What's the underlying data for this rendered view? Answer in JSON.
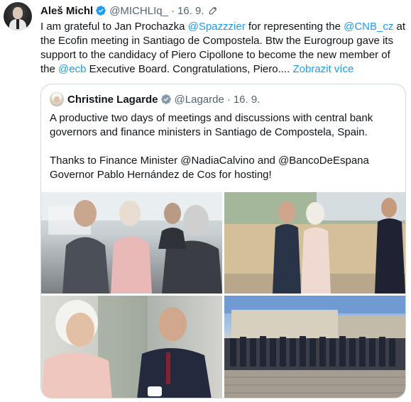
{
  "tweet": {
    "author_name": "Aleš Michl",
    "handle": "@MICHLIq_",
    "separator": "·",
    "date": "16. 9.",
    "text_parts": {
      "t1": "I am grateful to Jan Prochazka ",
      "mention1": "@Spazzzier",
      "t2": " for representing the ",
      "mention2": "@CNB_cz",
      "t3": " at the Ecofin meeting in Santiago de Compostela. Btw the Eurogroup gave its support to the candidacy of Piero Cipollone to become the new member of the ",
      "mention3": "@ecb",
      "t4": " Executive Board. Congratulations, Piero.... ",
      "show_more": "Zobrazit více"
    }
  },
  "quoted": {
    "author_name": "Christine Lagarde",
    "handle": "@Lagarde",
    "separator": "·",
    "date": "16. 9.",
    "paragraph1": "A productive two days of meetings and discussions with central bank governors and finance ministers in Santiago de Compostela, Spain.",
    "paragraph2": "Thanks to Finance Minister @NadiaCalvino and @BancoDeEspana Governor Pablo Hernández de Cos for hosting!"
  },
  "colors": {
    "accent": "#1d9bf0",
    "text": "#0f1419",
    "muted": "#536471",
    "border": "#cfd9de"
  },
  "icons": [
    "verified-badge-icon",
    "edited-pencil-icon"
  ]
}
